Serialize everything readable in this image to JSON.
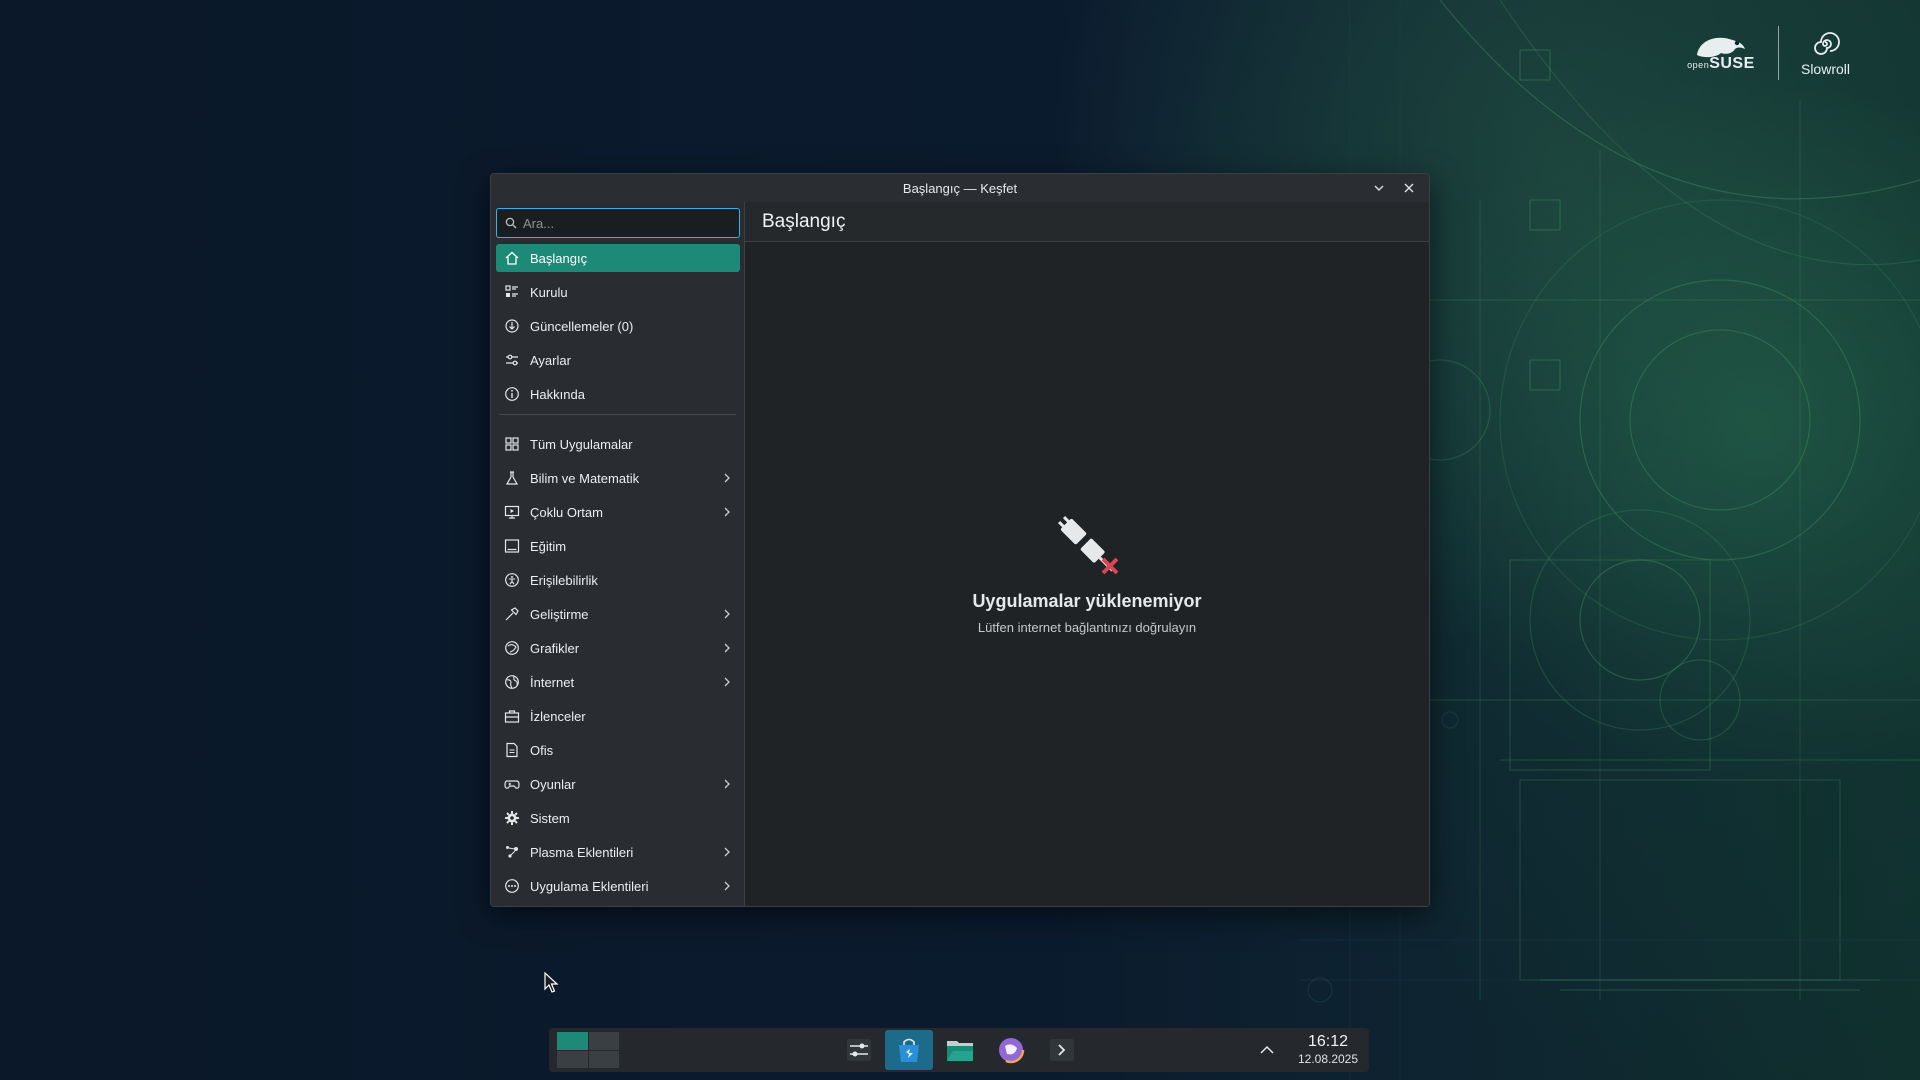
{
  "window": {
    "title": "Başlangıç — Keşfet",
    "minimize_glyph": "⌄",
    "close_glyph": "✕"
  },
  "search": {
    "placeholder": "Ara...",
    "value": ""
  },
  "sidebar": {
    "top_items": [
      {
        "label": "Başlangıç",
        "icon": "home-icon",
        "active": true
      },
      {
        "label": "Kurulu",
        "icon": "installed-list-icon"
      },
      {
        "label": "Güncellemeler (0)",
        "icon": "updates-icon"
      },
      {
        "label": "Ayarlar",
        "icon": "settings-sliders-icon"
      },
      {
        "label": "Hakkında",
        "icon": "info-icon"
      }
    ],
    "categories": [
      {
        "label": "Tüm Uygulamalar",
        "icon": "grid-icon",
        "expandable": false
      },
      {
        "label": "Bilim ve Matematik",
        "icon": "flask-icon",
        "expandable": true
      },
      {
        "label": "Çoklu Ortam",
        "icon": "multimedia-icon",
        "expandable": true
      },
      {
        "label": "Eğitim",
        "icon": "education-icon",
        "expandable": false
      },
      {
        "label": "Erişilebilirlik",
        "icon": "accessibility-icon",
        "expandable": false
      },
      {
        "label": "Geliştirme",
        "icon": "hammer-icon",
        "expandable": true
      },
      {
        "label": "Grafikler",
        "icon": "graphics-icon",
        "expandable": true
      },
      {
        "label": "İnternet",
        "icon": "globe-icon",
        "expandable": true
      },
      {
        "label": "İzlenceler",
        "icon": "toolbox-icon",
        "expandable": false
      },
      {
        "label": "Ofis",
        "icon": "office-icon",
        "expandable": false
      },
      {
        "label": "Oyunlar",
        "icon": "gamepad-icon",
        "expandable": true
      },
      {
        "label": "Sistem",
        "icon": "gear-icon",
        "expandable": false
      },
      {
        "label": "Plasma Eklentileri",
        "icon": "plasma-icon",
        "expandable": true
      },
      {
        "label": "Uygulama Eklentileri",
        "icon": "addons-icon",
        "expandable": true
      }
    ]
  },
  "main": {
    "header": "Başlangıç",
    "empty_title": "Uygulamalar yüklenemiyor",
    "empty_subtitle": "Lütfen internet bağlantınızı doğrulayın"
  },
  "branding": {
    "suse_small": "open",
    "suse": "SUSE",
    "slowroll": "Slowroll"
  },
  "taskbar": {
    "apps": [
      {
        "name": "system-settings",
        "icon": "settings-app-icon",
        "active": false
      },
      {
        "name": "discover",
        "icon": "discover-store-icon",
        "active": true
      },
      {
        "name": "dolphin",
        "icon": "file-manager-icon",
        "active": false
      },
      {
        "name": "firefox",
        "icon": "browser-icon",
        "active": false
      },
      {
        "name": "konsole",
        "icon": "terminal-icon",
        "active": false
      }
    ],
    "time": "16:12",
    "date": "12.08.2025"
  },
  "colors": {
    "accent": "#1d8a78",
    "focus": "#3daee9",
    "error_red": "#da4453"
  }
}
